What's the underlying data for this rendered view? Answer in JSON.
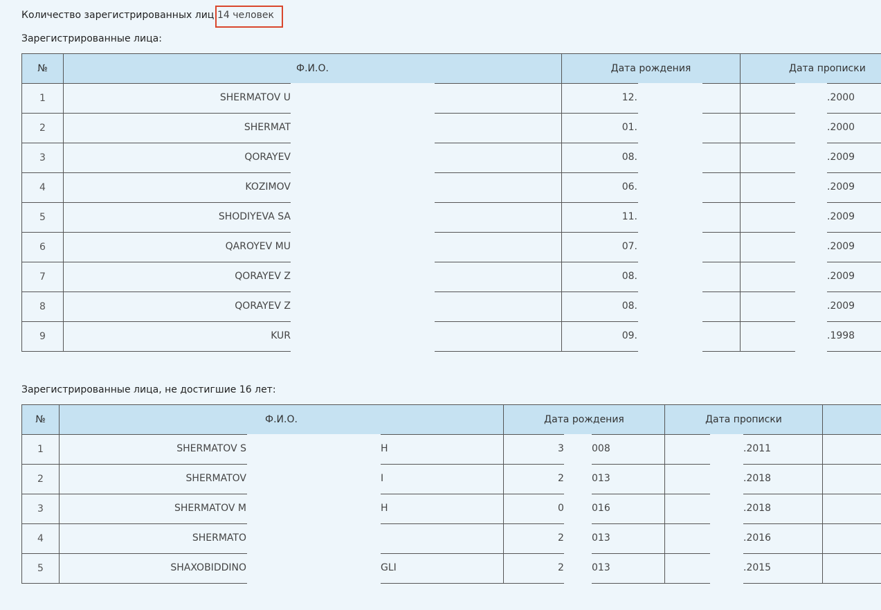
{
  "summary": {
    "count_label": "Количество зарегистрированных лиц:",
    "count_value": "14 человек"
  },
  "adults": {
    "title": "Зарегистрированные лица:",
    "headers": [
      "№",
      "Ф.И.О.",
      "Дата рождения",
      "Дата прописки"
    ],
    "rows": [
      {
        "n": "1",
        "name": "SHERMATOV U",
        "birth": "12.",
        "reg": ".2000"
      },
      {
        "n": "2",
        "name": "SHERMAT",
        "birth": "01.",
        "reg": ".2000"
      },
      {
        "n": "3",
        "name": "QORAYEV",
        "birth": "08.",
        "reg": ".2009"
      },
      {
        "n": "4",
        "name": "KOZIMOV",
        "birth": "06.",
        "reg": ".2009"
      },
      {
        "n": "5",
        "name": "SHODIYEVA SA",
        "birth": "11.",
        "reg": ".2009"
      },
      {
        "n": "6",
        "name": "QAROYEV MU",
        "birth": "07.",
        "reg": ".2009"
      },
      {
        "n": "7",
        "name": "QORAYEV Z",
        "birth": "08.",
        "reg": ".2009"
      },
      {
        "n": "8",
        "name": "QORAYEV Z",
        "birth": "08.",
        "reg": ".2009"
      },
      {
        "n": "9",
        "name": "KUR",
        "birth": "09.",
        "reg": ".1998"
      }
    ]
  },
  "minors": {
    "title": "Зарегистрированные лица, не достигшие 16 лет:",
    "headers": [
      "№",
      "Ф.И.О.",
      "Дата рождения",
      "Дата прописки"
    ],
    "rows": [
      {
        "n": "1",
        "name_a": "SHERMATOV S",
        "name_b": "H",
        "birth_a": "3",
        "birth_b": "008",
        "reg": ".2011"
      },
      {
        "n": "2",
        "name_a": "SHERMATOV",
        "name_b": "I",
        "birth_a": "2",
        "birth_b": "013",
        "reg": ".2018"
      },
      {
        "n": "3",
        "name_a": "SHERMATOV M",
        "name_b": "H",
        "birth_a": "0",
        "birth_b": "016",
        "reg": ".2018"
      },
      {
        "n": "4",
        "name_a": "SHERMATO",
        "name_b": "",
        "birth_a": "2",
        "birth_b": "013",
        "reg": ".2016"
      },
      {
        "n": "5",
        "name_a": "SHAXOBIDDINO",
        "name_b": "GLI",
        "birth_a": "2",
        "birth_b": "013",
        "reg": ".2015"
      }
    ]
  }
}
